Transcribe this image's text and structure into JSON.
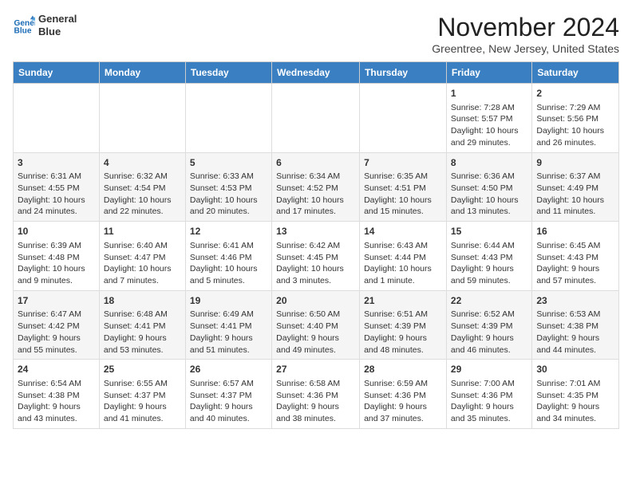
{
  "header": {
    "logo_line1": "General",
    "logo_line2": "Blue",
    "month_title": "November 2024",
    "location": "Greentree, New Jersey, United States"
  },
  "weekdays": [
    "Sunday",
    "Monday",
    "Tuesday",
    "Wednesday",
    "Thursday",
    "Friday",
    "Saturday"
  ],
  "weeks": [
    [
      {
        "day": "",
        "info": ""
      },
      {
        "day": "",
        "info": ""
      },
      {
        "day": "",
        "info": ""
      },
      {
        "day": "",
        "info": ""
      },
      {
        "day": "",
        "info": ""
      },
      {
        "day": "1",
        "info": "Sunrise: 7:28 AM\nSunset: 5:57 PM\nDaylight: 10 hours and 29 minutes."
      },
      {
        "day": "2",
        "info": "Sunrise: 7:29 AM\nSunset: 5:56 PM\nDaylight: 10 hours and 26 minutes."
      }
    ],
    [
      {
        "day": "3",
        "info": "Sunrise: 6:31 AM\nSunset: 4:55 PM\nDaylight: 10 hours and 24 minutes."
      },
      {
        "day": "4",
        "info": "Sunrise: 6:32 AM\nSunset: 4:54 PM\nDaylight: 10 hours and 22 minutes."
      },
      {
        "day": "5",
        "info": "Sunrise: 6:33 AM\nSunset: 4:53 PM\nDaylight: 10 hours and 20 minutes."
      },
      {
        "day": "6",
        "info": "Sunrise: 6:34 AM\nSunset: 4:52 PM\nDaylight: 10 hours and 17 minutes."
      },
      {
        "day": "7",
        "info": "Sunrise: 6:35 AM\nSunset: 4:51 PM\nDaylight: 10 hours and 15 minutes."
      },
      {
        "day": "8",
        "info": "Sunrise: 6:36 AM\nSunset: 4:50 PM\nDaylight: 10 hours and 13 minutes."
      },
      {
        "day": "9",
        "info": "Sunrise: 6:37 AM\nSunset: 4:49 PM\nDaylight: 10 hours and 11 minutes."
      }
    ],
    [
      {
        "day": "10",
        "info": "Sunrise: 6:39 AM\nSunset: 4:48 PM\nDaylight: 10 hours and 9 minutes."
      },
      {
        "day": "11",
        "info": "Sunrise: 6:40 AM\nSunset: 4:47 PM\nDaylight: 10 hours and 7 minutes."
      },
      {
        "day": "12",
        "info": "Sunrise: 6:41 AM\nSunset: 4:46 PM\nDaylight: 10 hours and 5 minutes."
      },
      {
        "day": "13",
        "info": "Sunrise: 6:42 AM\nSunset: 4:45 PM\nDaylight: 10 hours and 3 minutes."
      },
      {
        "day": "14",
        "info": "Sunrise: 6:43 AM\nSunset: 4:44 PM\nDaylight: 10 hours and 1 minute."
      },
      {
        "day": "15",
        "info": "Sunrise: 6:44 AM\nSunset: 4:43 PM\nDaylight: 9 hours and 59 minutes."
      },
      {
        "day": "16",
        "info": "Sunrise: 6:45 AM\nSunset: 4:43 PM\nDaylight: 9 hours and 57 minutes."
      }
    ],
    [
      {
        "day": "17",
        "info": "Sunrise: 6:47 AM\nSunset: 4:42 PM\nDaylight: 9 hours and 55 minutes."
      },
      {
        "day": "18",
        "info": "Sunrise: 6:48 AM\nSunset: 4:41 PM\nDaylight: 9 hours and 53 minutes."
      },
      {
        "day": "19",
        "info": "Sunrise: 6:49 AM\nSunset: 4:41 PM\nDaylight: 9 hours and 51 minutes."
      },
      {
        "day": "20",
        "info": "Sunrise: 6:50 AM\nSunset: 4:40 PM\nDaylight: 9 hours and 49 minutes."
      },
      {
        "day": "21",
        "info": "Sunrise: 6:51 AM\nSunset: 4:39 PM\nDaylight: 9 hours and 48 minutes."
      },
      {
        "day": "22",
        "info": "Sunrise: 6:52 AM\nSunset: 4:39 PM\nDaylight: 9 hours and 46 minutes."
      },
      {
        "day": "23",
        "info": "Sunrise: 6:53 AM\nSunset: 4:38 PM\nDaylight: 9 hours and 44 minutes."
      }
    ],
    [
      {
        "day": "24",
        "info": "Sunrise: 6:54 AM\nSunset: 4:38 PM\nDaylight: 9 hours and 43 minutes."
      },
      {
        "day": "25",
        "info": "Sunrise: 6:55 AM\nSunset: 4:37 PM\nDaylight: 9 hours and 41 minutes."
      },
      {
        "day": "26",
        "info": "Sunrise: 6:57 AM\nSunset: 4:37 PM\nDaylight: 9 hours and 40 minutes."
      },
      {
        "day": "27",
        "info": "Sunrise: 6:58 AM\nSunset: 4:36 PM\nDaylight: 9 hours and 38 minutes."
      },
      {
        "day": "28",
        "info": "Sunrise: 6:59 AM\nSunset: 4:36 PM\nDaylight: 9 hours and 37 minutes."
      },
      {
        "day": "29",
        "info": "Sunrise: 7:00 AM\nSunset: 4:36 PM\nDaylight: 9 hours and 35 minutes."
      },
      {
        "day": "30",
        "info": "Sunrise: 7:01 AM\nSunset: 4:35 PM\nDaylight: 9 hours and 34 minutes."
      }
    ]
  ]
}
